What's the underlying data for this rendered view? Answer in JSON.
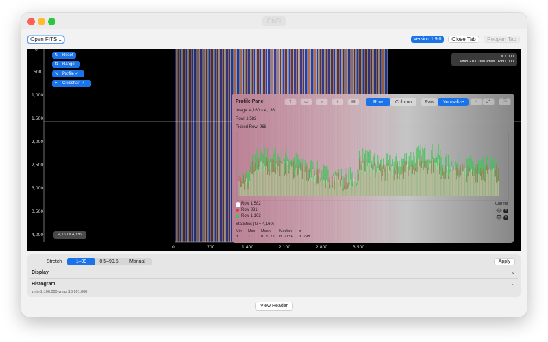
{
  "window": {
    "title": "FitsPi"
  },
  "toolbar": {
    "open_label": "Open FITS...",
    "version_label": "Version 1.9.0",
    "close_tab_label": "Close Tab",
    "reopen_tab_label": "Reopen Tab"
  },
  "viewer": {
    "y_ticks": [
      "0",
      "500",
      "1,000",
      "1,500",
      "2,000",
      "2,500",
      "3,000",
      "3,500",
      "4,000"
    ],
    "x_ticks": [
      "0",
      "700",
      "1,400",
      "2,100",
      "2,800",
      "3,500"
    ],
    "controls": [
      {
        "icon": "↻",
        "label": "Reset"
      },
      {
        "icon": "⇅",
        "label": "Range"
      },
      {
        "icon": "∿",
        "label": "Profile ✓"
      },
      {
        "icon": "⌖",
        "label": "Crosshair ✓"
      }
    ],
    "info": {
      "zoom": "× 1.000",
      "levels": "vmin 2100.000   vmax 16991.000"
    },
    "size_badge": "4,160 × 4,136"
  },
  "profile_panel": {
    "title": "Profile Panel",
    "image_line": "Image: 4,160 × 4,136",
    "row_line": "Row: 1,582",
    "picked_line": "Picked Row: 968",
    "mode_row": "Row",
    "mode_column": "Column",
    "scale_raw": "Raw",
    "scale_normalize": "Normalize",
    "legend": [
      {
        "label": "Row 1,582",
        "color": "#ffffff"
      },
      {
        "label": "Row 331",
        "color": "#e53935"
      },
      {
        "label": "Row 1,102",
        "color": "#43c35a"
      }
    ],
    "current_label": "Current",
    "stats": {
      "title": "Statistics (N = 4,160)",
      "headers": [
        "Min",
        "Max",
        "Mean",
        "Median",
        "σ"
      ],
      "values": [
        "0",
        "1",
        "0.3172",
        "0.2154",
        "0.298"
      ]
    }
  },
  "stretch": {
    "label": "Stretch",
    "options": [
      "1–99",
      "0.5–99.5",
      "Manual"
    ],
    "apply_label": "Apply"
  },
  "display": {
    "label": "Display"
  },
  "histogram": {
    "label": "Histogram",
    "range": "vmin 2,100.000   vmax 16,991.000"
  },
  "footer": {
    "view_header_label": "View Header"
  }
}
